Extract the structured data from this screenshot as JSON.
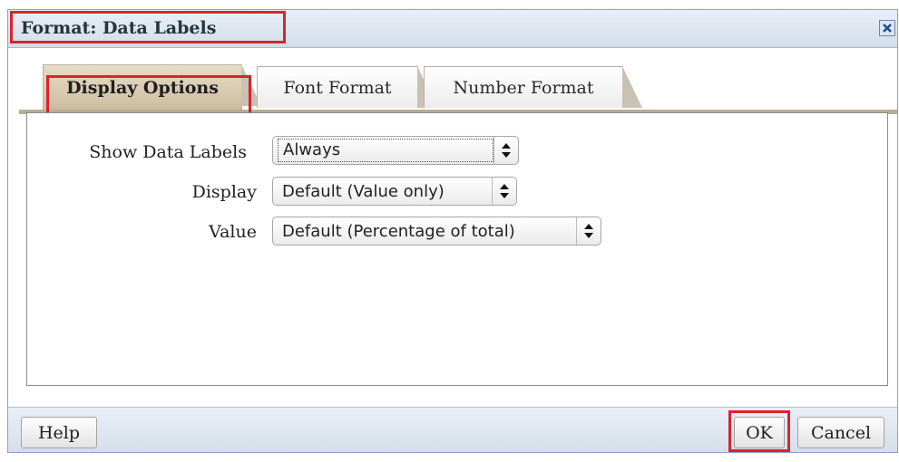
{
  "dialog": {
    "title": "Format: Data Labels",
    "close_icon": "close-icon"
  },
  "tabs": [
    {
      "label": "Display Options",
      "active": true
    },
    {
      "label": "Font Format",
      "active": false
    },
    {
      "label": "Number Format",
      "active": false
    }
  ],
  "form": {
    "show_data_labels": {
      "label": "Show Data Labels",
      "value": "Always"
    },
    "display": {
      "label": "Display",
      "value": "Default (Value only)"
    },
    "value": {
      "label": "Value",
      "value": "Default (Percentage of total)"
    }
  },
  "footer": {
    "help_label": "Help",
    "ok_label": "OK",
    "cancel_label": "Cancel"
  },
  "colors": {
    "highlight": "#d9242e",
    "active_tab": "#cdbd9f",
    "title_bar": "#d3dde9"
  }
}
